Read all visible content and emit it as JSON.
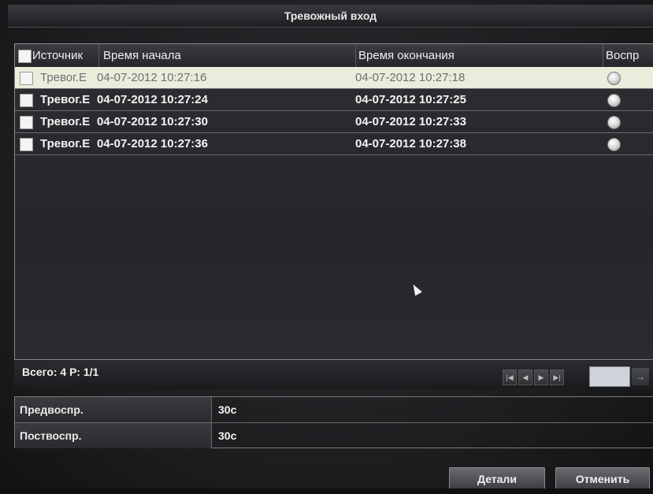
{
  "window": {
    "title": "Тревожный вход"
  },
  "table": {
    "headers": {
      "source": "Источник",
      "start": "Время начала",
      "end": "Время окончания",
      "play": "Воспр"
    },
    "rows": [
      {
        "source": "Тревог.Е",
        "start": "04-07-2012 10:27:16",
        "end": "04-07-2012 10:27:18",
        "selected": true
      },
      {
        "source": "Тревог.Е",
        "start": "04-07-2012 10:27:24",
        "end": "04-07-2012 10:27:25",
        "selected": false
      },
      {
        "source": "Тревог.Е",
        "start": "04-07-2012 10:27:30",
        "end": "04-07-2012 10:27:33",
        "selected": false
      },
      {
        "source": "Тревог.Е",
        "start": "04-07-2012 10:27:36",
        "end": "04-07-2012 10:27:38",
        "selected": false
      }
    ]
  },
  "footer": {
    "total_label": "Всего: 4  Р: 1/1"
  },
  "pager_icons": [
    "first-page-icon",
    "prev-page-icon",
    "next-page-icon",
    "last-page-icon",
    "go-arrow-icon"
  ],
  "settings": {
    "pre_label": "Предвоспр.",
    "pre_value": "30с",
    "post_label": "Поствоспр.",
    "post_value": "30с"
  },
  "buttons": {
    "details": "Детали",
    "cancel": "Отменить"
  }
}
